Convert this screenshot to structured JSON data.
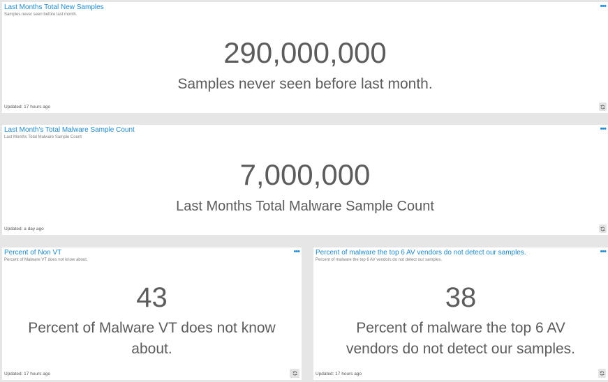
{
  "panels": [
    {
      "title": "Last Months Total New Samples",
      "subtitle": "Samples never seen before last month.",
      "value": "290,000,000",
      "label": "Samples never seen before last month.",
      "updated": "Updated: 17 hours ago"
    },
    {
      "title": "Last Month's Total Malware Sample Count",
      "subtitle": "Last Months Total Malware Sample Count",
      "value": "7,000,000",
      "label": "Last Months Total Malware Sample Count",
      "updated": "Updated: a day ago"
    },
    {
      "title": "Percent of Non VT",
      "subtitle": "Percent of Malware VT does not know about.",
      "value": "43",
      "label": "Percent of Malware VT does not know about.",
      "updated": "Updated: 17 hours ago"
    },
    {
      "title": "Percent of malware the top 6 AV vendors do not detect our samples.",
      "subtitle": "Percent of malware the top 6 AV vendors do not detect our samples.",
      "value": "38",
      "label": "Percent of malware the top 6 AV vendors do not detect our samples.",
      "updated": "Updated: 17 hours ago"
    }
  ],
  "icons": {
    "menu": "more-options-icon",
    "refresh": "refresh-icon"
  },
  "colors": {
    "title": "#1f8ad6",
    "metric_text": "#5c5c5c",
    "background": "#e6e6e6",
    "panel": "#ffffff"
  }
}
